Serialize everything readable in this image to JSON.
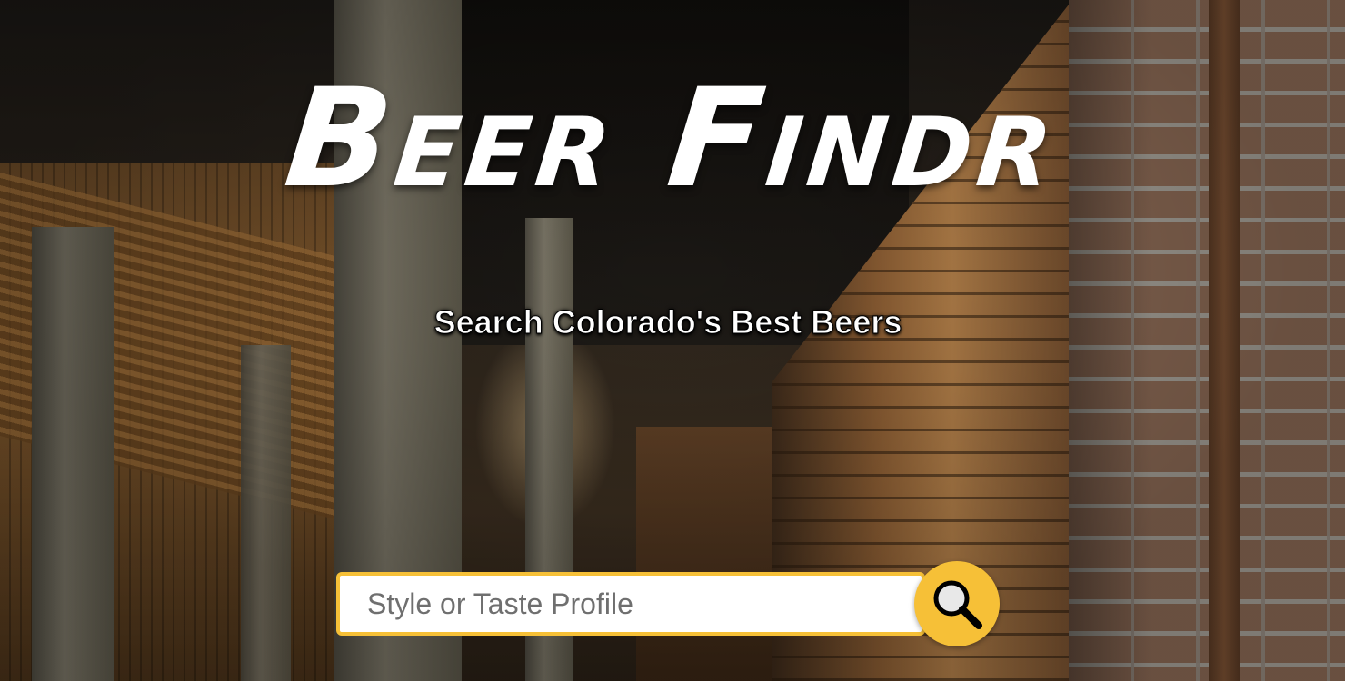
{
  "header": {
    "title": "Beer Findr",
    "subtitle": "Search Colorado's Best Beers"
  },
  "search": {
    "placeholder": "Style or Taste Profile",
    "value": "",
    "button_icon": "magnifying-glass-icon"
  },
  "colors": {
    "accent": "#f6c037",
    "title_text": "#ffffff",
    "input_background": "#ffffff"
  }
}
